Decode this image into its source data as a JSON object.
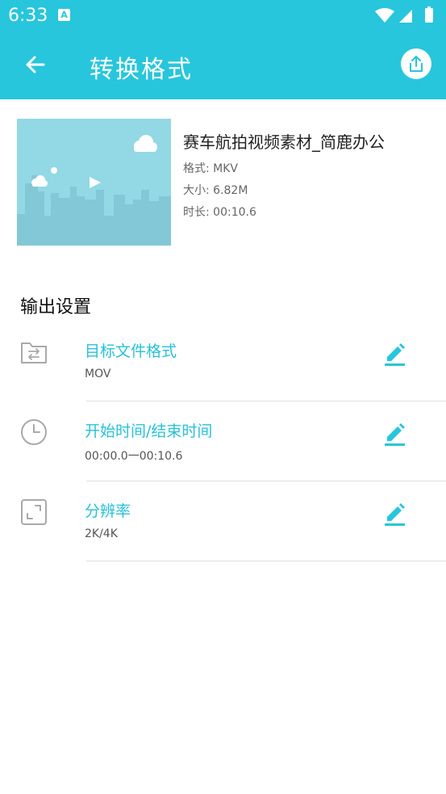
{
  "status_bar": {
    "time": "6:33",
    "notification_letter": "A"
  },
  "app_bar": {
    "title": "转换格式"
  },
  "video": {
    "name": "赛车航拍视频素材_简鹿办公",
    "format_label": "格式:",
    "format_value": "MKV",
    "size_label": "大小:",
    "size_value": "6.82M",
    "duration_label": "时长:",
    "duration_value": "00:10.6"
  },
  "output_settings": {
    "title": "输出设置",
    "items": [
      {
        "label": "目标文件格式",
        "value": "MOV",
        "icon": "folder-convert-icon"
      },
      {
        "label": "开始时间/结束时间",
        "value": "00:00.0一00:10.6",
        "icon": "clock-icon"
      },
      {
        "label": "分辨率",
        "value": "2K/4K",
        "icon": "resize-icon"
      }
    ]
  },
  "colors": {
    "accent": "#27c6dc",
    "thumbnail_bg": "#93d8e5"
  }
}
